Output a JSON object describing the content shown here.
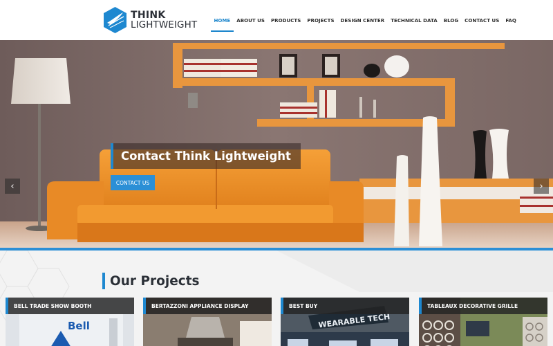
{
  "brand": {
    "line1": "THINK",
    "line2": "LIGHTWEIGHT",
    "accent": "#1e88d0"
  },
  "nav": [
    {
      "label": "HOME",
      "active": true
    },
    {
      "label": "ABOUT US",
      "active": false
    },
    {
      "label": "PRODUCTS",
      "active": false
    },
    {
      "label": "PROJECTS",
      "active": false
    },
    {
      "label": "DESIGN CENTER",
      "active": false
    },
    {
      "label": "TECHNICAL DATA",
      "active": false
    },
    {
      "label": "BLOG",
      "active": false
    },
    {
      "label": "CONTACT US",
      "active": false
    },
    {
      "label": "FAQ",
      "active": false
    }
  ],
  "hero": {
    "caption": "Contact Think Lightweight",
    "button_label": "CONTACT US",
    "prev_icon": "chevron-left-icon",
    "next_icon": "chevron-right-icon",
    "prev_glyph": "‹",
    "next_glyph": "›"
  },
  "projects": {
    "title": "Our Projects",
    "cards": [
      {
        "label": "BELL TRADE SHOW BOOTH",
        "logo_text": "Bell"
      },
      {
        "label": "BERTAZZONI APPLIANCE DISPLAY"
      },
      {
        "label": "BEST BUY",
        "sign_text": "WEARABLE TECH"
      },
      {
        "label": "TABLEAUX DECORATIVE GRILLE"
      }
    ]
  }
}
